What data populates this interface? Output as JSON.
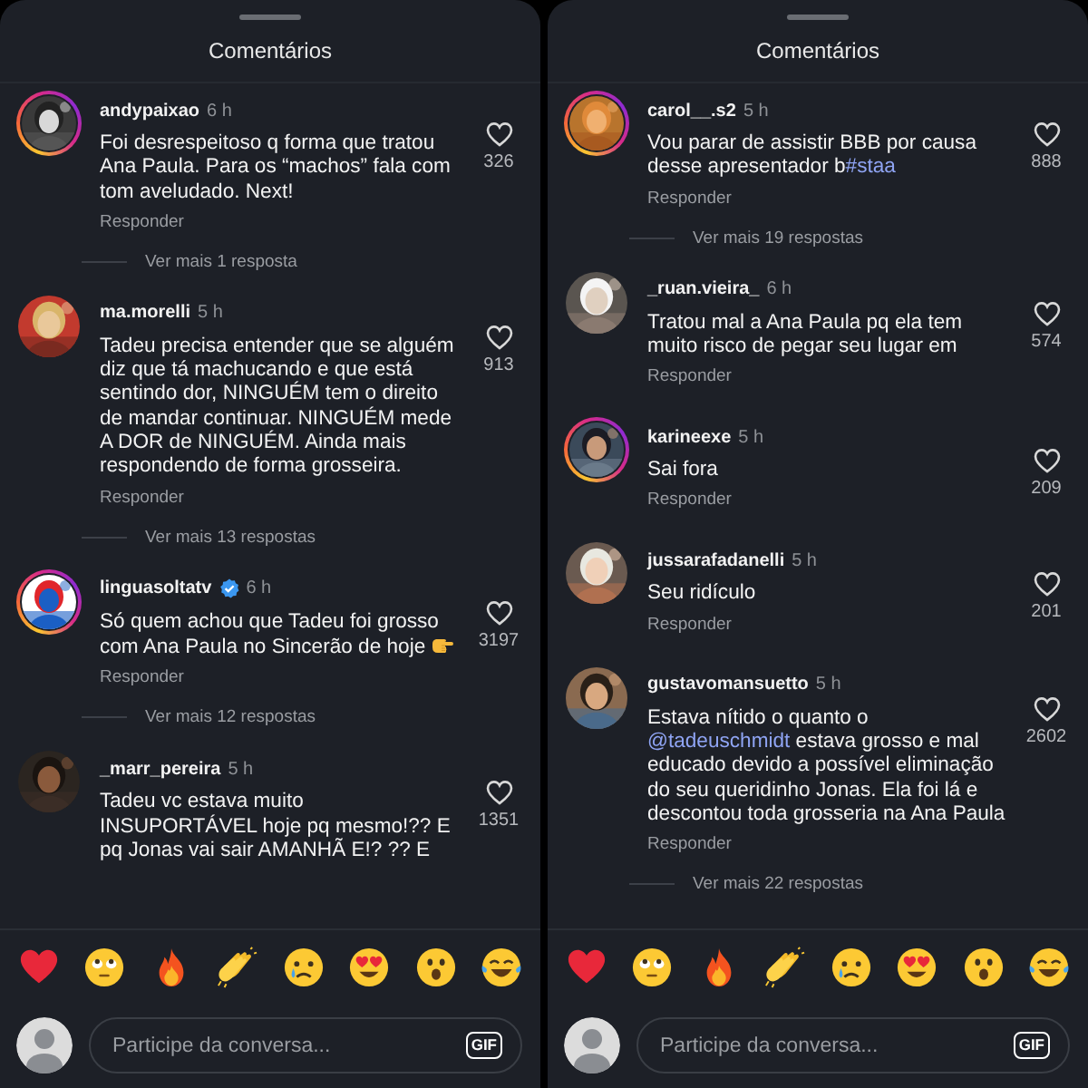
{
  "panels": [
    {
      "title": "Comentários",
      "comments": [
        {
          "username": "andypaixao",
          "verified": false,
          "story": true,
          "time": "6 h",
          "segments": [
            {
              "kind": "plain",
              "text": "Foi desrespeitoso q forma que tratou Ana Paula. Para os “machos” fala com tom aveludado. Next!"
            }
          ],
          "likes": "326",
          "reply": "Responder",
          "more_replies": "Ver mais 1 resposta"
        },
        {
          "username": "ma.morelli",
          "verified": false,
          "story": false,
          "time": "5 h",
          "segments": [
            {
              "kind": "plain",
              "text": "Tadeu precisa entender que se alguém diz que tá machucando e que está sentindo dor, NINGUÉM tem o direito de mandar continuar. NINGUÉM mede A DOR de NINGUÉM. Ainda mais respondendo de forma grosseira."
            }
          ],
          "likes": "913",
          "reply": "Responder",
          "more_replies": "Ver mais 13 respostas"
        },
        {
          "username": "linguasoltatv",
          "verified": true,
          "story": true,
          "time": "6 h",
          "segments": [
            {
              "kind": "plain",
              "text": "Só quem achou que Tadeu foi grosso com Ana Paula no Sincerão de hoje"
            },
            {
              "kind": "pointing-hand"
            }
          ],
          "likes": "3197",
          "reply": "Responder",
          "more_replies": "Ver mais 12 respostas"
        },
        {
          "username": "_marr_pereira",
          "verified": false,
          "story": false,
          "time": "5 h",
          "segments": [
            {
              "kind": "plain",
              "text": "Tadeu vc estava muito INSUPORTÁVEL hoje pq mesmo!?? E pq Jonas vai sair AMANHÃ E!? ?? E"
            }
          ],
          "likes": "1351"
        }
      ],
      "reactions": [
        {
          "kind": "heart"
        },
        {
          "kind": "eye-roll"
        },
        {
          "kind": "fire"
        },
        {
          "kind": "clap"
        },
        {
          "kind": "crying"
        },
        {
          "kind": "heart-eyes"
        },
        {
          "kind": "surprised"
        },
        {
          "kind": "laughing"
        }
      ],
      "input": {
        "placeholder": "Participe da conversa...",
        "gif": "GIF"
      }
    },
    {
      "title": "Comentários",
      "comments": [
        {
          "username": "carol__.s2",
          "verified": false,
          "story": true,
          "time": "5 h",
          "segments": [
            {
              "kind": "plain",
              "text": "Vou parar de assistir BBB por causa desse apresentador b"
            },
            {
              "kind": "link",
              "text": "#staa"
            }
          ],
          "likes": "888",
          "reply": "Responder",
          "more_replies": "Ver mais 19 respostas"
        },
        {
          "username": "_ruan.vieira_",
          "verified": false,
          "story": false,
          "time": "6 h",
          "segments": [
            {
              "kind": "plain",
              "text": "Tratou mal a Ana Paula pq ela tem muito risco de pegar seu lugar em"
            }
          ],
          "likes": "574",
          "reply": "Responder"
        },
        {
          "username": "karineexe",
          "verified": false,
          "story": true,
          "time": "5 h",
          "segments": [
            {
              "kind": "plain",
              "text": "Sai fora"
            }
          ],
          "likes": "209",
          "reply": "Responder"
        },
        {
          "username": "jussarafadanelli",
          "verified": false,
          "story": false,
          "time": "5 h",
          "segments": [
            {
              "kind": "plain",
              "text": "Seu ridículo"
            }
          ],
          "likes": "201",
          "reply": "Responder"
        },
        {
          "username": "gustavomansuetto",
          "verified": false,
          "story": false,
          "time": "5 h",
          "segments": [
            {
              "kind": "plain",
              "text": "Estava nítido o quanto o "
            },
            {
              "kind": "link",
              "text": "@tadeuschmidt"
            },
            {
              "kind": "plain",
              "text": " estava grosso e mal educado devido a possível eliminação do seu queridinho Jonas. Ela foi lá e descontou toda grosseria na Ana Paula"
            }
          ],
          "likes": "2602",
          "reply": "Responder",
          "more_replies": "Ver mais 22 respostas"
        }
      ],
      "reactions": [
        {
          "kind": "heart"
        },
        {
          "kind": "eye-roll"
        },
        {
          "kind": "fire"
        },
        {
          "kind": "clap"
        },
        {
          "kind": "crying"
        },
        {
          "kind": "heart-eyes"
        },
        {
          "kind": "surprised"
        },
        {
          "kind": "laughing"
        }
      ],
      "input": {
        "placeholder": "Participe da conversa...",
        "gif": "GIF"
      }
    }
  ]
}
